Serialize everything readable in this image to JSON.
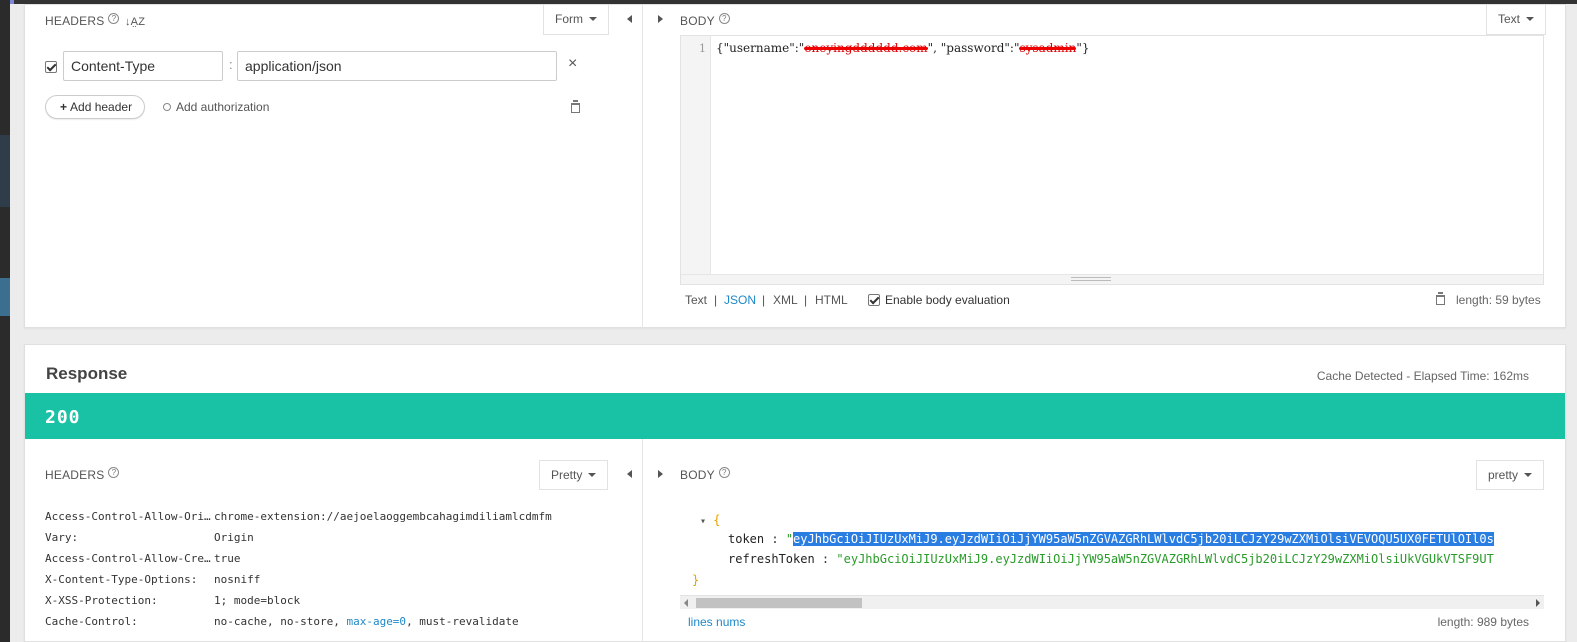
{
  "request": {
    "headers": {
      "title": "HEADERS",
      "help_glyph": "?",
      "sort_glyph": "↓A̤Z",
      "mode_label": "Form",
      "rows": [
        {
          "enabled": true,
          "name": "Content-Type",
          "separator": ":",
          "value": "application/json"
        }
      ],
      "remove_glyph": "×",
      "add_header_label": "Add header",
      "add_authorization_label": "Add authorization"
    },
    "body": {
      "title": "BODY",
      "help_glyph": "?",
      "mode_label": "Text",
      "line_number": "1",
      "code_prefix": "{\"username\":\"",
      "code_username": "oneyingdddddd.com",
      "code_mid": "\", \"password\":\"",
      "code_password": "sysadmin",
      "code_suffix": "\"}",
      "formats": [
        "Text",
        "JSON",
        "XML",
        "HTML"
      ],
      "active_format": "JSON",
      "format_separator": "|",
      "enable_eval_label": "Enable body evaluation",
      "length_label": "length: 59 bytes"
    }
  },
  "response": {
    "title": "Response",
    "elapsed_label": "Cache Detected - Elapsed Time: 162ms",
    "status_code": "200",
    "status_color": "#1ac2a5",
    "headers": {
      "title": "HEADERS",
      "help_glyph": "?",
      "mode_label": "Pretty",
      "rows": [
        {
          "key": "Access-Control-Allow-Ori…",
          "value": "chrome-extension://aejoelaoggembcahagimdiliamlcdmfm"
        },
        {
          "key": "Vary:",
          "value": "Origin"
        },
        {
          "key": "Access-Control-Allow-Cre…",
          "value": "true"
        },
        {
          "key": "X-Content-Type-Options:",
          "value": "nosniff"
        },
        {
          "key": "X-XSS-Protection:",
          "value": "1; mode=block"
        },
        {
          "key": "Cache-Control:",
          "value_parts": [
            "no-cache, no-store, ",
            "max-age=0",
            ", must-revalidate"
          ]
        }
      ]
    },
    "body": {
      "title": "BODY",
      "help_glyph": "?",
      "mode_label": "pretty",
      "open_brace": "{",
      "close_brace": "}",
      "collapse_glyph": "▾",
      "entries": [
        {
          "key": "token",
          "colon": " :  ",
          "quote": "\"",
          "value": "eyJhbGciOiJIUzUxMiJ9.eyJzdWIiOiJjYW95aW5nZGVAZGRhLWlvdC5jb20iLCJzY29wZXMiOlsiVEVOQU5UX0FETUlOIl0s"
        },
        {
          "key": "refreshToken",
          "colon": " :  ",
          "quote": "\"",
          "value": "eyJhbGciOiJIUzUxMiJ9.eyJzdWIiOiJjYW95aW5nZGVAZGRhLWlvdC5jb20iLCJzY29wZXMiOlsiUkVGUkVTSF9UT"
        }
      ],
      "lines_nums_label": "lines nums",
      "length_label": "length: 989 bytes"
    }
  },
  "colors": {
    "accent_link": "#1e88c7",
    "status_bar": "#1ac2a5",
    "selection": "#2a7de1",
    "json_string": "#2a9b2a",
    "json_brace": "#e4a100"
  }
}
